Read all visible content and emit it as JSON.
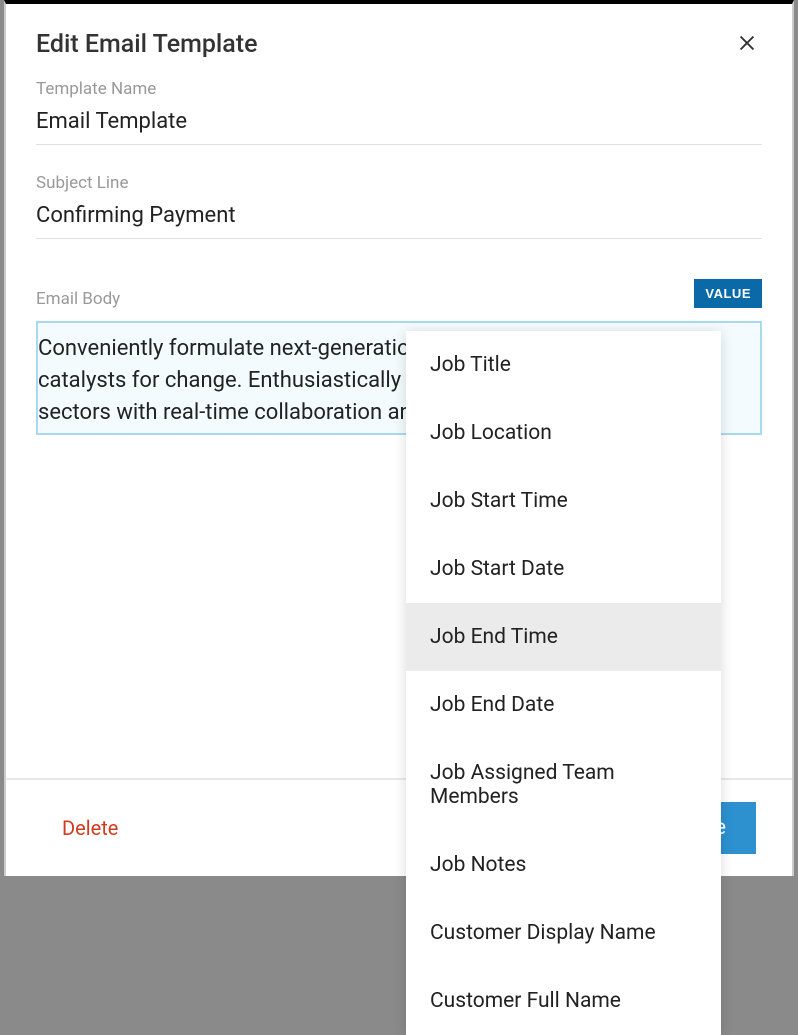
{
  "modal": {
    "title": "Edit Email Template",
    "templateName": {
      "label": "Template Name",
      "value": "Email Template"
    },
    "subjectLine": {
      "label": "Subject Line",
      "value": "Confirming Payment"
    },
    "emailBody": {
      "label": "Email Body",
      "value": "Conveniently formulate next-generation manufactured products and catalysts for change. Enthusiastically transform sustainable core sectors with real-time collaboration and idea-sharing."
    },
    "valueButton": "VALUE",
    "delete": "Delete",
    "save": "ave"
  },
  "dropdown": {
    "items": [
      {
        "label": "Job Title",
        "highlighted": false
      },
      {
        "label": "Job Location",
        "highlighted": false
      },
      {
        "label": "Job Start Time",
        "highlighted": false
      },
      {
        "label": "Job Start Date",
        "highlighted": false
      },
      {
        "label": "Job End Time",
        "highlighted": true
      },
      {
        "label": "Job End Date",
        "highlighted": false
      },
      {
        "label": "Job Assigned Team Members",
        "highlighted": false
      },
      {
        "label": "Job Notes",
        "highlighted": false
      },
      {
        "label": "Customer Display Name",
        "highlighted": false
      },
      {
        "label": "Customer Full Name",
        "highlighted": false
      }
    ]
  }
}
